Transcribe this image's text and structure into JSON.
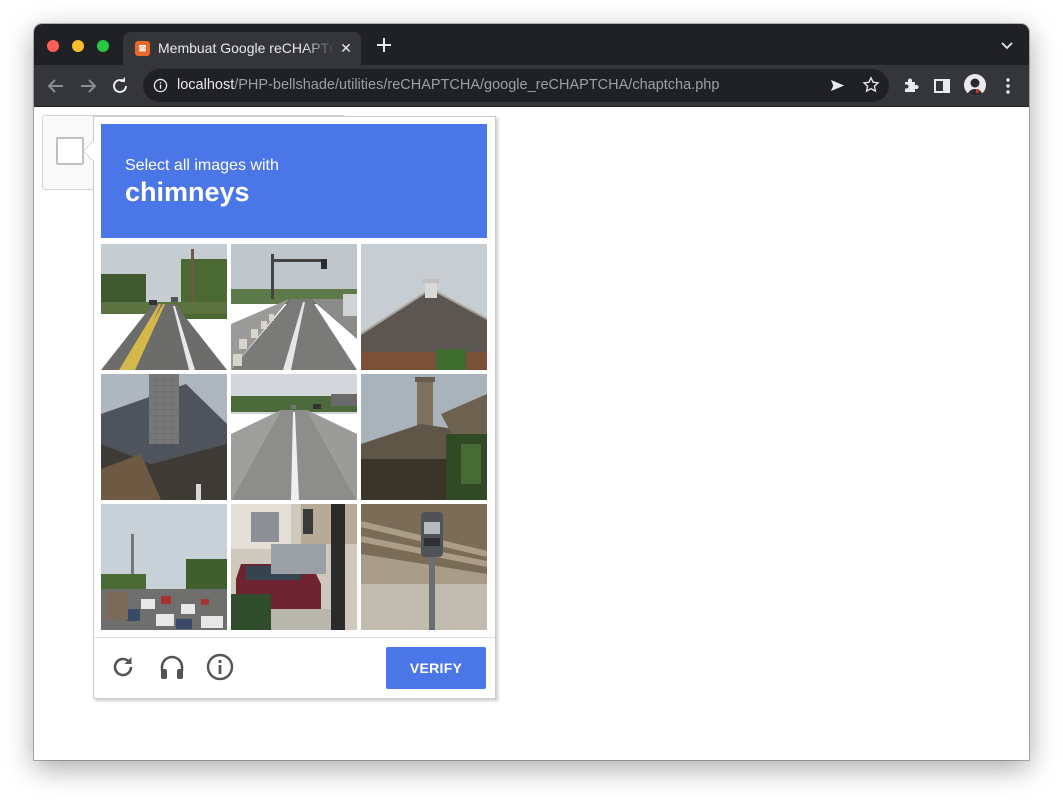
{
  "browser": {
    "tab_title": "Membuat Google reCHAPTCHA",
    "tab_close_glyph": "✕",
    "favicon_text": "⊠",
    "url_host": "localhost",
    "url_path": "/PHP-bellshade/utilities/reCHAPTCHA/google_reCHAPTCHA/chaptcha.php",
    "traffic_light_colors": [
      "#ff5f57",
      "#febc2e",
      "#28c840"
    ]
  },
  "captcha": {
    "prompt": "Select all images with",
    "target": "chimneys",
    "header_color": "#4a76e8",
    "tiles": [
      {
        "id": 1,
        "scene": "road with trees"
      },
      {
        "id": 2,
        "scene": "road with barriers"
      },
      {
        "id": 3,
        "scene": "roof with chimney"
      },
      {
        "id": 4,
        "scene": "roof with chimney"
      },
      {
        "id": 5,
        "scene": "highway"
      },
      {
        "id": 6,
        "scene": "house with chimney"
      },
      {
        "id": 7,
        "scene": "busy road"
      },
      {
        "id": 8,
        "scene": "parking lot with cars"
      },
      {
        "id": 9,
        "scene": "parking meter"
      }
    ],
    "footer": {
      "reload_icon": "reload-icon",
      "audio_icon": "headphones-icon",
      "info_icon": "info-icon",
      "verify_label": "VERIFY"
    }
  }
}
